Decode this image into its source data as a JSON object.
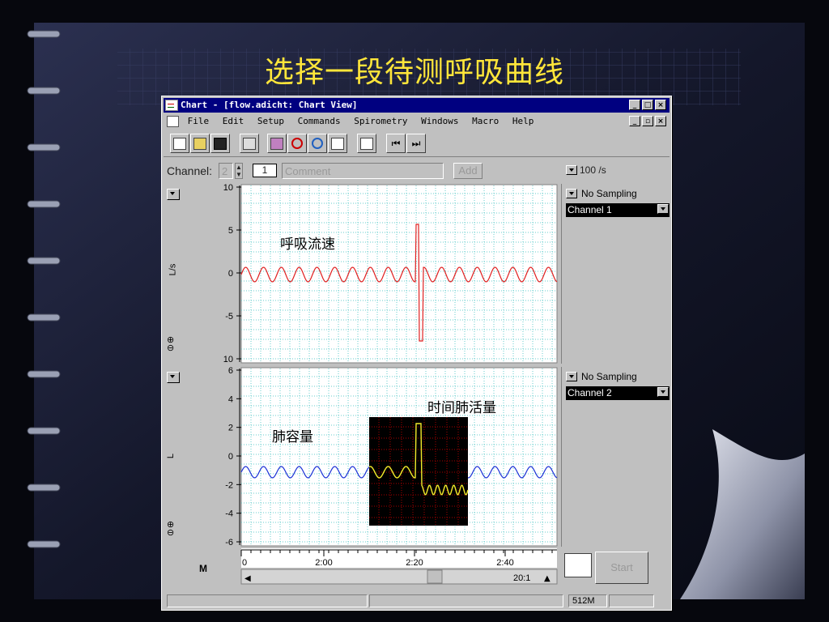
{
  "slide": {
    "title": "选择一段待测呼吸曲线"
  },
  "window": {
    "title": "Chart - [flow.adicht: Chart View]",
    "menu": [
      "File",
      "Edit",
      "Setup",
      "Commands",
      "Spirometry",
      "Windows",
      "Macro",
      "Help"
    ]
  },
  "toolbar": {
    "buttons": [
      "chart-view-icon",
      "open-folder-icon",
      "save-disk-icon",
      "print-icon",
      "zoom-view-icon",
      "magnifier-icon",
      "link-icon",
      "data-pad-icon",
      "notebook-icon",
      "jump-start-icon",
      "jump-end-icon"
    ]
  },
  "channel_bar": {
    "label": "Channel:",
    "channel_value": "2",
    "comment_number": "1",
    "comment_placeholder": "Comment",
    "add_label": "Add",
    "rate": "100 /s"
  },
  "channels": [
    {
      "unit": "L/s",
      "annotation": "呼吸流速",
      "sampling": "No Sampling",
      "selected_channel": "Channel 1",
      "trace_color": "#e02020",
      "y_ticks": [
        "10",
        "5",
        "0",
        "-5",
        "10"
      ]
    },
    {
      "unit": "L",
      "annotation": "肺容量",
      "annotation2": "时间肺活量",
      "sampling": "No Sampling",
      "selected_channel": "Channel 2",
      "trace_color": "#1a2fd6",
      "highlight_color": "#f2ea2a",
      "y_ticks": [
        "6",
        "4",
        "2",
        "0",
        "-2",
        "-4",
        "-6"
      ]
    }
  ],
  "time_axis": {
    "ticks": [
      "0",
      "2:00",
      "2:20",
      "2:40"
    ],
    "zoom_ratio": "20:1"
  },
  "controls": {
    "start_label": "Start",
    "marker_label": "M"
  },
  "status": {
    "memory": "512M"
  }
}
